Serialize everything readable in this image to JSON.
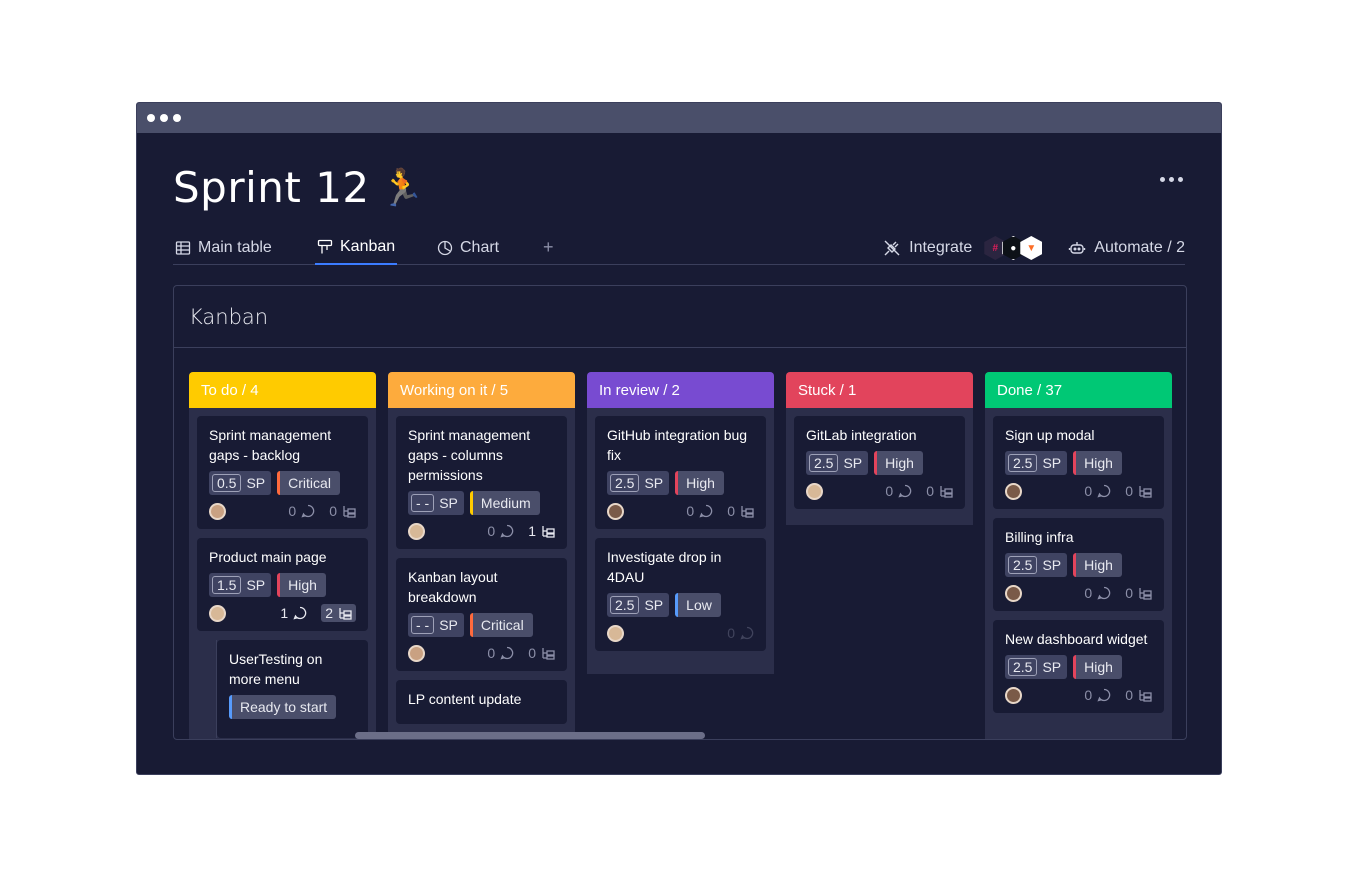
{
  "window": {
    "controls": [
      "dot",
      "dot",
      "dot"
    ]
  },
  "header": {
    "title": "Sprint 12",
    "emoji": "🏃",
    "more_icon": "more-horizontal-icon"
  },
  "tabs": [
    {
      "label": "Main table",
      "icon": "table-icon",
      "active": false
    },
    {
      "label": "Kanban",
      "icon": "kanban-icon",
      "active": true
    },
    {
      "label": "Chart",
      "icon": "chart-icon",
      "active": false
    }
  ],
  "tab_add": "+",
  "tools": {
    "integrate_label": "Integrate",
    "automate_label": "Automate / 2",
    "apps": [
      "slack",
      "github",
      "gitlab"
    ]
  },
  "panel": {
    "title": "Kanban"
  },
  "colors": {
    "todo": "#ffcb00",
    "working": "#fdab3d",
    "review": "#784bd1",
    "stuck": "#e2445c",
    "done": "#00c875",
    "accent": "#3b7cff"
  },
  "columns": [
    {
      "header": "To do / 4",
      "cards": [
        {
          "title": "Sprint management gaps - backlog",
          "sp": "0.5",
          "sp_unit": "SP",
          "priority": "Critical",
          "comments": "0",
          "subitems": "0"
        },
        {
          "title": "Product main page",
          "sp": "1.5",
          "sp_unit": "SP",
          "priority": "High",
          "comments": "1",
          "subitems": "2"
        },
        {
          "title": "UserTesting on more menu",
          "status": "Ready to start"
        }
      ]
    },
    {
      "header": "Working on it / 5",
      "cards": [
        {
          "title": "Sprint management gaps - columns permissions",
          "sp": "- -",
          "sp_unit": "SP",
          "priority": "Medium",
          "comments": "0",
          "subitems": "1"
        },
        {
          "title": "Kanban layout breakdown",
          "sp": "- -",
          "sp_unit": "SP",
          "priority": "Critical",
          "comments": "0",
          "subitems": "0"
        },
        {
          "title": "LP content update"
        }
      ]
    },
    {
      "header": "In review / 2",
      "cards": [
        {
          "title": "GitHub integration bug fix",
          "sp": "2.5",
          "sp_unit": "SP",
          "priority": "High",
          "comments": "0",
          "subitems": "0"
        },
        {
          "title": "Investigate drop in 4DAU",
          "sp": "2.5",
          "sp_unit": "SP",
          "priority": "Low",
          "comments": "0"
        }
      ]
    },
    {
      "header": "Stuck / 1",
      "cards": [
        {
          "title": "GitLab integration",
          "sp": "2.5",
          "sp_unit": "SP",
          "priority": "High",
          "comments": "0",
          "subitems": "0"
        }
      ]
    },
    {
      "header": "Done  / 37",
      "cards": [
        {
          "title": "Sign up modal",
          "sp": "2.5",
          "sp_unit": "SP",
          "priority": "High",
          "comments": "0",
          "subitems": "0"
        },
        {
          "title": "Billing infra",
          "sp": "2.5",
          "sp_unit": "SP",
          "priority": "High",
          "comments": "0",
          "subitems": "0"
        },
        {
          "title": "New dashboard widget",
          "sp": "2.5",
          "sp_unit": "SP",
          "priority": "High",
          "comments": "0",
          "subitems": "0"
        }
      ]
    }
  ]
}
